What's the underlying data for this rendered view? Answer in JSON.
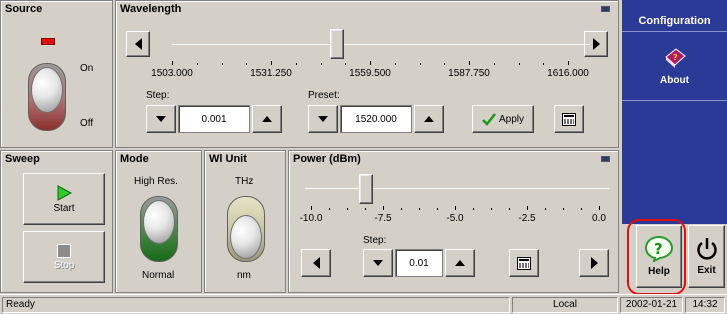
{
  "colors": {
    "sidebar_bg": "#2b3a96",
    "sidebar_text": "#ffffff",
    "led_on": "#e11111",
    "highlight_ring": "#e01010",
    "sweep_start_green": "#2ecb2e"
  },
  "source": {
    "title": "Source",
    "on_label": "On",
    "off_label": "Off",
    "state": "On"
  },
  "wavelength": {
    "title": "Wavelength",
    "ticks": [
      "1503.000",
      "1531.250",
      "1559.500",
      "1587.750",
      "1616.000"
    ],
    "slider_value": 1559.5,
    "step_label": "Step:",
    "step_value": "0.001",
    "preset_label": "Preset:",
    "preset_value": "1520.000",
    "apply_label": "Apply"
  },
  "sweep": {
    "title": "Sweep",
    "start_label": "Start",
    "stop_label": "Stop"
  },
  "mode": {
    "title": "Mode",
    "top_label": "High Res.",
    "bottom_label": "Normal",
    "state": "Normal"
  },
  "wl_unit": {
    "title": "Wl Unit",
    "top_label": "THz",
    "bottom_label": "nm",
    "state": "nm"
  },
  "power": {
    "title": "Power (dBm)",
    "ticks": [
      "-10.0",
      "-7.5",
      "-5.0",
      "-2.5",
      "0.0"
    ],
    "slider_value": -7.5,
    "step_label": "Step:",
    "step_value": "0.01"
  },
  "sidebar": {
    "configuration_label": "Configuration",
    "about_label": "About",
    "help_label": "Help",
    "exit_label": "Exit",
    "icons": [
      "about-book-icon",
      "help-question-icon",
      "power-icon"
    ]
  },
  "statusbar": {
    "status": "Ready",
    "mode": "Local",
    "date": "2002-01-21",
    "time": "14:32"
  }
}
